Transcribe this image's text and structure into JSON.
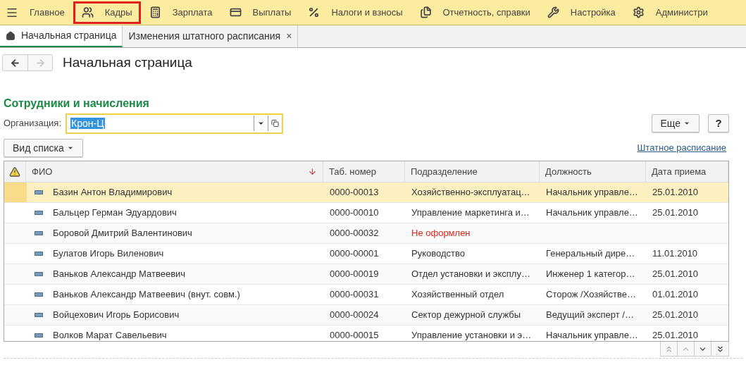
{
  "menu": [
    {
      "label": "Главное",
      "highlighted": false
    },
    {
      "label": "Кадры",
      "highlighted": true
    },
    {
      "label": "Зарплата",
      "highlighted": false
    },
    {
      "label": "Выплаты",
      "highlighted": false
    },
    {
      "label": "Налоги и взносы",
      "highlighted": false
    },
    {
      "label": "Отчетность, справки",
      "highlighted": false
    },
    {
      "label": "Настройка",
      "highlighted": false
    },
    {
      "label": "Администри",
      "highlighted": false
    }
  ],
  "tabs": [
    {
      "label": "Начальная страница",
      "selected": true
    },
    {
      "label": "Изменения штатного расписания",
      "selected": false,
      "close": "×"
    }
  ],
  "page_title": "Начальная страница",
  "section_title": "Сотрудники и начисления",
  "organization": {
    "label": "Организация:",
    "value": "Крон-Ц"
  },
  "more_button": "Еще",
  "help_button": "?",
  "view_button": "Вид списка",
  "staff_link": "Штатное расписание",
  "table": {
    "columns": [
      "ФИО",
      "Таб. номер",
      "Подразделение",
      "Должность",
      "Дата приема"
    ],
    "rows": [
      {
        "selected": true,
        "department_alert": false,
        "cells": [
          "Базин Антон Владимирович",
          "0000-00013",
          "Хозяйственно-эксплуатац…",
          "Начальник управле…",
          "25.01.2010"
        ]
      },
      {
        "selected": false,
        "department_alert": false,
        "cells": [
          "Бальцер Герман Эдуардович",
          "0000-00010",
          "Управление маркетинга и…",
          "Начальник управле…",
          "25.01.2010"
        ]
      },
      {
        "selected": false,
        "department_alert": true,
        "cells": [
          "Боровой Дмитрий Валентинович",
          "0000-00032",
          "Не оформлен",
          "",
          ""
        ]
      },
      {
        "selected": false,
        "department_alert": false,
        "cells": [
          "Булатов Игорь Виленович",
          "0000-00001",
          "Руководство",
          "Генеральный дире…",
          "11.01.2010"
        ]
      },
      {
        "selected": false,
        "department_alert": false,
        "cells": [
          "Ваньков Александр Матвеевич",
          "0000-00019",
          "Отдел установки и эксплу…",
          "Инженер 1 категор…",
          "25.01.2010"
        ]
      },
      {
        "selected": false,
        "department_alert": false,
        "cells": [
          "Ваньков Александр Матвеевич (внут. совм.)",
          "0000-00031",
          "Хозяйственный отдел",
          "Сторож /Хозяйстве…",
          "01.01.2010"
        ]
      },
      {
        "selected": false,
        "department_alert": false,
        "cells": [
          "Войцехович Игорь Борисович",
          "0000-00024",
          "Сектор дежурной службы",
          "Ведущий эксперт /…",
          "25.01.2010"
        ]
      },
      {
        "selected": false,
        "department_alert": false,
        "cells": [
          "Волков Марат Савельевич",
          "0000-00015",
          "Управление установки и э…",
          "Начальник управле…",
          "25.01.2010"
        ]
      }
    ]
  }
}
